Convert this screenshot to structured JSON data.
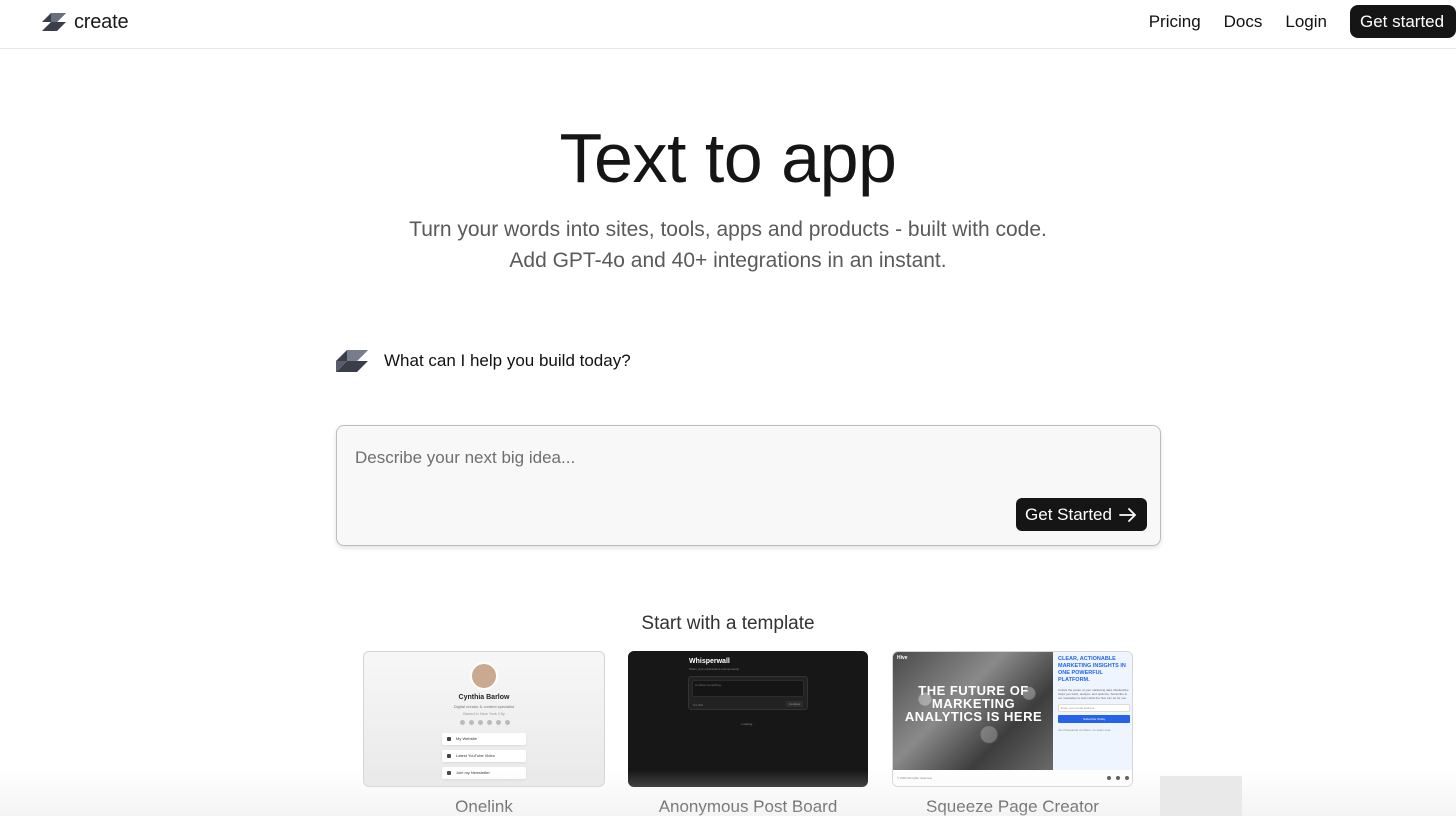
{
  "header": {
    "brand": "create",
    "nav": [
      {
        "label": "Pricing"
      },
      {
        "label": "Docs"
      },
      {
        "label": "Login"
      }
    ],
    "cta_label": "Get started"
  },
  "hero": {
    "title": "Text to app",
    "subtitle_line1": "Turn your words into sites, tools, apps and products - built with code.",
    "subtitle_line2": "Add GPT-4o and 40+ integrations in an instant."
  },
  "assistant": {
    "prompt": "What can I help you build today?"
  },
  "idea": {
    "placeholder": "Describe your next big idea...",
    "value": "",
    "button_label": "Get Started"
  },
  "templates": {
    "heading": "Start with a template",
    "items": [
      {
        "label": "Onelink",
        "preview": {
          "name": "Cynthia Barlow",
          "desc": "Digital creator & content specialist",
          "location": "Based in New York City",
          "links": [
            "My Website",
            "Latest YouTube Video",
            "Join my Newsletter"
          ]
        }
      },
      {
        "label": "Anonymous Post Board",
        "preview": {
          "app_name": "Whisperwall",
          "tagline": "Share your confessions anonymously",
          "input_placeholder": "Confess something...",
          "char_count": "0/1,000",
          "button": "Confess",
          "status": "Loading..."
        }
      },
      {
        "label": "Squeeze Page Creator",
        "preview": {
          "brand": "Hive",
          "headline": "THE FUTURE OF MARKETING ANALYTICS IS HERE",
          "side_heading": "CLEAR, ACTIONABLE MARKETING INSIGHTS IN ONE POWERFUL PLATFORM.",
          "side_text": "Unlock the power of your marketing data. MarketHive helps you track, analyze, and optimize. Subscribe to our newsletter to learn what the hive can do for you.",
          "email_placeholder": "Enter your email address",
          "button": "Subscribe Today",
          "note": "Join thousands of others, no spam ever.",
          "footer": "© 2024 All rights reserved."
        }
      }
    ]
  },
  "colors": {
    "primary_button": "#151515",
    "accent_blue": "#2563eb",
    "text_muted": "#5a5a5a"
  },
  "icons": {
    "brand": "create-logo-icon",
    "arrow": "arrow-right-icon"
  }
}
